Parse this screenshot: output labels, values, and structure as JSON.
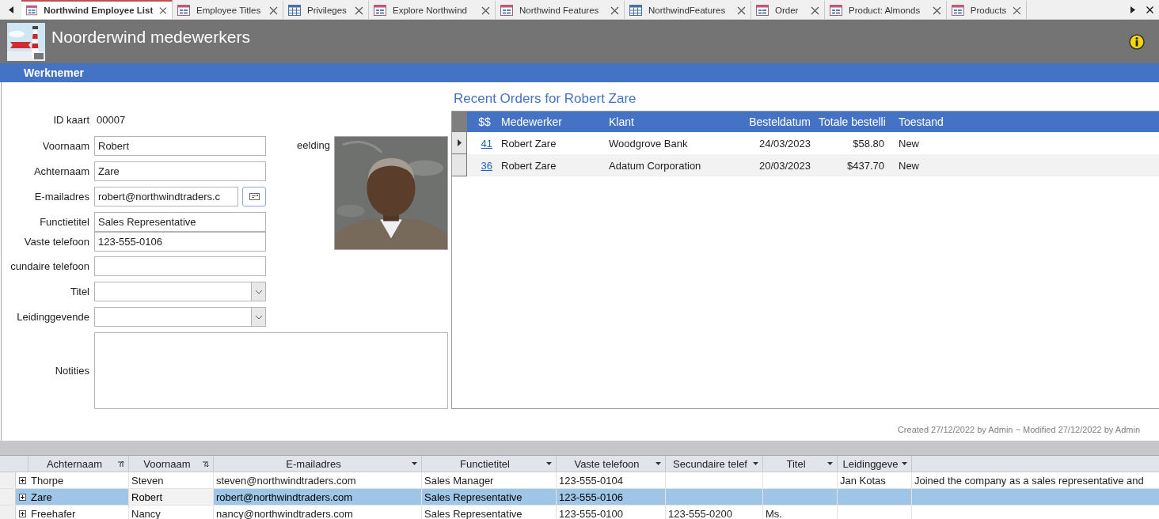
{
  "tabs": [
    {
      "label": "Northwind Employee List",
      "kind": "form",
      "selected": true
    },
    {
      "label": "Employee Titles",
      "kind": "form",
      "selected": false
    },
    {
      "label": "Privileges",
      "kind": "table",
      "selected": false
    },
    {
      "label": "Explore Northwind",
      "kind": "form",
      "selected": false
    },
    {
      "label": "Northwind Features",
      "kind": "form",
      "selected": false
    },
    {
      "label": "NorthwindFeatures",
      "kind": "table",
      "selected": false
    },
    {
      "label": "Order",
      "kind": "form",
      "selected": false
    },
    {
      "label": "Product: Almonds",
      "kind": "form",
      "selected": false
    },
    {
      "label": "Products",
      "kind": "form",
      "selected": false
    }
  ],
  "header": {
    "title": "Noorderwind medewerkers"
  },
  "section": {
    "title": "Werknemer"
  },
  "form": {
    "id_label": "ID kaart",
    "id_value": "00007",
    "photo_label": "eelding",
    "fields": [
      {
        "label": "Voornaam",
        "kind": "text",
        "value": "Robert"
      },
      {
        "label": "Achternaam",
        "kind": "text",
        "value": "Zare"
      },
      {
        "label": "E-mailadres",
        "kind": "email",
        "value": "robert@northwindtraders.c"
      },
      {
        "label": "Functietitel",
        "kind": "text",
        "value": "Sales Representative"
      },
      {
        "label": "Vaste telefoon",
        "kind": "text",
        "value": "123-555-0106"
      },
      {
        "label": "cundaire telefoon",
        "kind": "text"
      },
      {
        "label": "Titel",
        "kind": "combo"
      },
      {
        "label": "Leidinggevende",
        "kind": "combo"
      },
      {
        "label": "Notities",
        "kind": "memo"
      }
    ]
  },
  "orders": {
    "title": "Recent Orders for Robert Zare",
    "columns": [
      "$$",
      "Medewerker",
      "Klant",
      "Besteldatum",
      "Totale bestelli",
      "Toestand"
    ],
    "rows": [
      {
        "id": "41",
        "employee": "Robert Zare",
        "customer": "Woodgrove Bank",
        "date": "24/03/2023",
        "total": "$58.80",
        "status": "New",
        "current": true
      },
      {
        "id": "36",
        "employee": "Robert Zare",
        "customer": "Adatum Corporation",
        "date": "20/03/2023",
        "total": "$437.70",
        "status": "New",
        "current": false
      }
    ]
  },
  "footer": {
    "text": "Created 27/12/2022 by Admin ~  Modified 27/12/2022 by Admin"
  },
  "sheet": {
    "columns": [
      {
        "label": "Achternaam",
        "kind": "ascending"
      },
      {
        "label": "Voornaam",
        "kind": "descending"
      },
      {
        "label": "E-mailadres",
        "kind": "filter"
      },
      {
        "label": "Functietitel",
        "kind": "filter"
      },
      {
        "label": "Vaste telefoon",
        "kind": "filter"
      },
      {
        "label": "Secundaire telef",
        "kind": "filter"
      },
      {
        "label": "Titel",
        "kind": "filter"
      },
      {
        "label": "Leidinggeve",
        "kind": "filter"
      }
    ],
    "rows": [
      {
        "last_name": "Thorpe",
        "first_name": "Steven",
        "email": "steven@northwindtraders.com",
        "job_title": "Sales Manager",
        "phone": "123-555-0104",
        "manager": "Jan Kotas",
        "notes": "Joined the company as a sales representative and",
        "selected": false
      },
      {
        "last_name": "Zare",
        "first_name": "Robert",
        "email": "robert@northwindtraders.com",
        "job_title": "Sales Representative",
        "phone": "123-555-0106",
        "selected": true
      },
      {
        "last_name": "Freehafer",
        "first_name": "Nancy",
        "email": "nancy@northwindtraders.com",
        "job_title": "Sales Representative",
        "phone": "123-555-0100",
        "phone2": "123-555-0200",
        "title": "Ms.",
        "selected": false
      }
    ]
  }
}
